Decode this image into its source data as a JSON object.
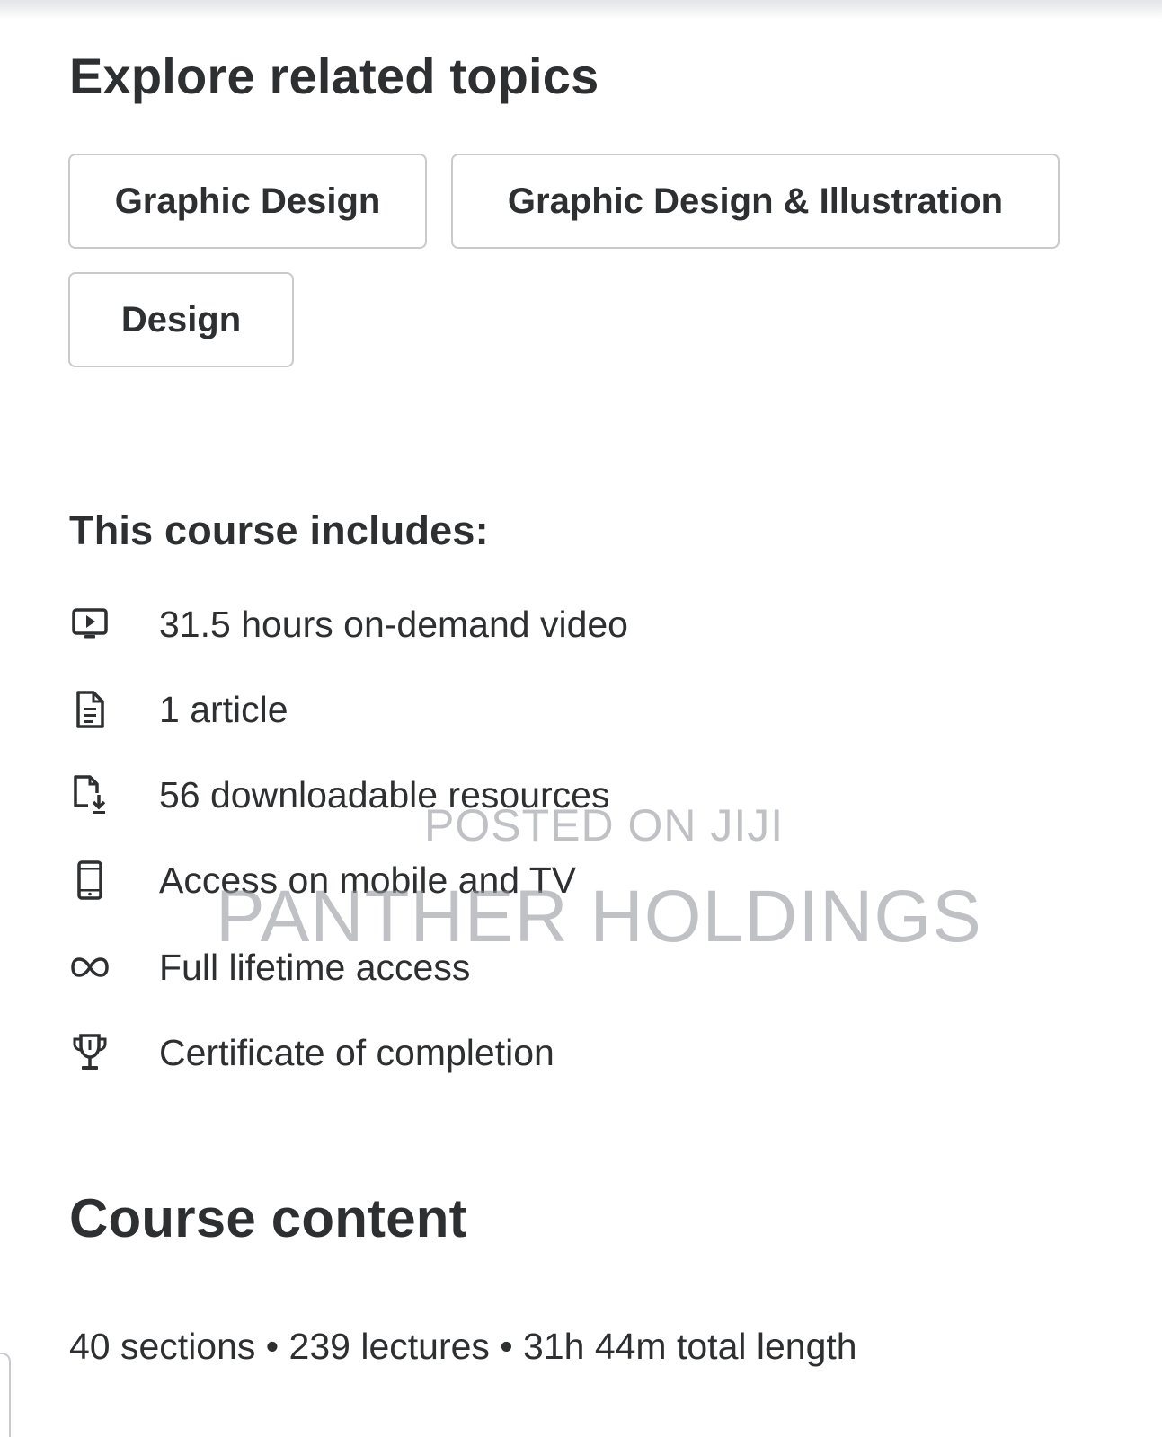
{
  "related": {
    "title": "Explore related topics",
    "topics": [
      "Graphic Design",
      "Graphic Design & Illustration",
      "Design"
    ]
  },
  "includes": {
    "title": "This course includes:",
    "items": [
      {
        "icon": "video-icon",
        "label": "31.5 hours on-demand video"
      },
      {
        "icon": "article-icon",
        "label": "1 article"
      },
      {
        "icon": "download-file-icon",
        "label": "56 downloadable resources"
      },
      {
        "icon": "mobile-icon",
        "label": "Access on mobile and TV"
      },
      {
        "icon": "infinity-icon",
        "label": "Full lifetime access"
      },
      {
        "icon": "trophy-icon",
        "label": "Certificate of completion"
      }
    ]
  },
  "course_content": {
    "title": "Course content",
    "meta": "40 sections • 239 lectures • 31h 44m total length"
  },
  "watermark": {
    "line1": "POSTED ON JIJI",
    "line2": "PANTHER HOLDINGS"
  }
}
